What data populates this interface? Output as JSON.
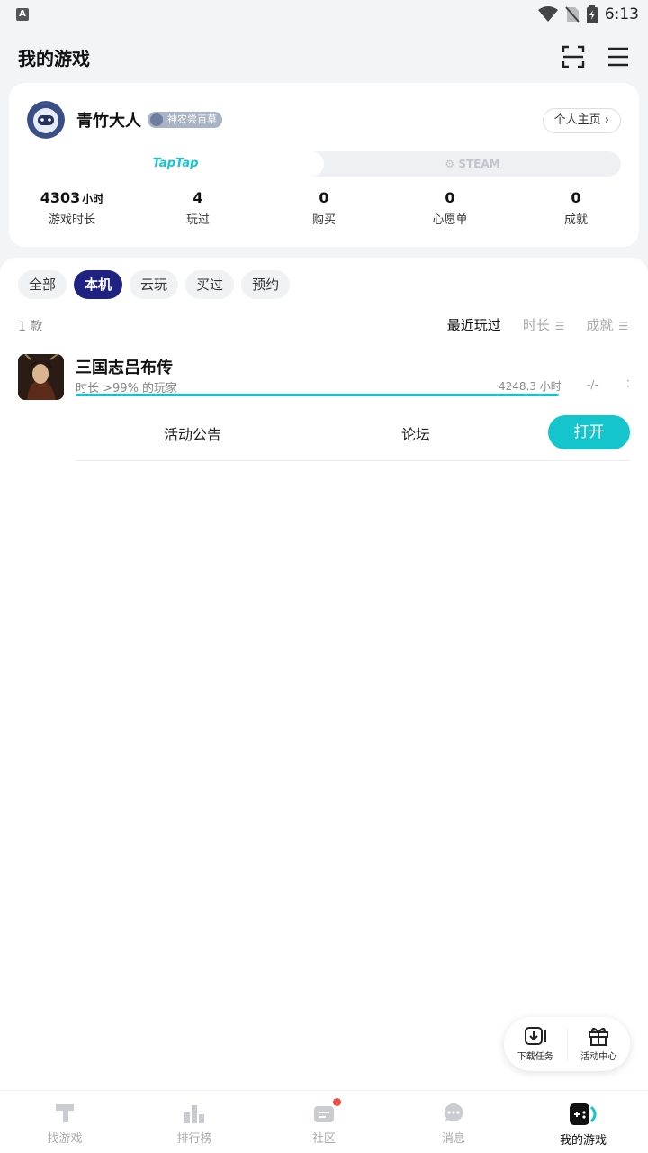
{
  "status_bar": {
    "time": "6:13",
    "left_icon": "A"
  },
  "header": {
    "title": "我的游戏"
  },
  "profile": {
    "username": "青竹大人",
    "badge": "神农尝百草",
    "homepage_btn": "个人主页 ›",
    "platforms": {
      "taptap": "TapTap",
      "steam": "STEAM"
    },
    "stats": [
      {
        "value": "4303",
        "unit": "小时",
        "label": "游戏时长"
      },
      {
        "value": "4",
        "unit": "",
        "label": "玩过"
      },
      {
        "value": "0",
        "unit": "",
        "label": "购买"
      },
      {
        "value": "0",
        "unit": "",
        "label": "心愿单"
      },
      {
        "value": "0",
        "unit": "",
        "label": "成就"
      }
    ]
  },
  "filters": [
    "全部",
    "本机",
    "云玩",
    "买过",
    "预约"
  ],
  "active_filter": "本机",
  "list": {
    "count": "1 款",
    "sorts": {
      "recent": "最近玩过",
      "duration": "时长",
      "achievement": "成就"
    }
  },
  "game": {
    "name": "三国志吕布传",
    "rank_text": "时长 >99% 的玩家",
    "hours": "4248.3 小时",
    "progress": 1.0,
    "achievement": "-/-",
    "actions": {
      "announcement": "活动公告",
      "forum": "论坛",
      "open": "打开"
    }
  },
  "floating": {
    "download": "下载任务",
    "activity": "活动中心"
  },
  "bottom_nav": [
    "找游戏",
    "排行榜",
    "社区",
    "消息",
    "我的游戏"
  ],
  "colors": {
    "accent": "#15c5ce",
    "chip_active": "#1f2280",
    "notification": "#f04b45"
  }
}
